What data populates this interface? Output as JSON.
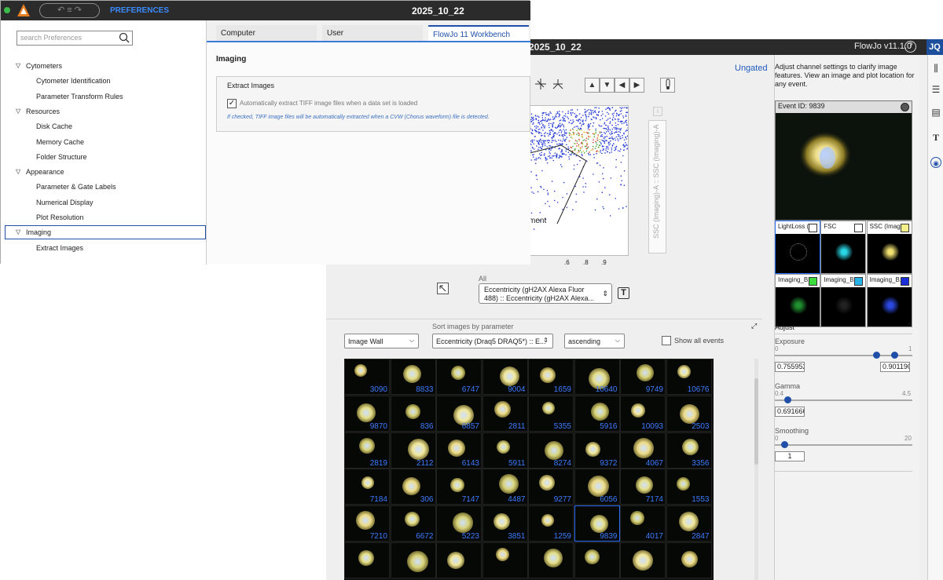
{
  "prefs": {
    "window_title": "PREFERENCES",
    "date": "2025_10_22",
    "search_placeholder": "search Preferences",
    "tree": [
      {
        "label": "Cytometers",
        "level": 0
      },
      {
        "label": "Cytometer Identification",
        "level": 1
      },
      {
        "label": "Parameter Transform Rules",
        "level": 1
      },
      {
        "label": "Resources",
        "level": 0
      },
      {
        "label": "Disk Cache",
        "level": 1
      },
      {
        "label": "Memory Cache",
        "level": 1
      },
      {
        "label": "Folder Structure",
        "level": 1
      },
      {
        "label": "Appearance",
        "level": 0
      },
      {
        "label": "Parameter & Gate Labels",
        "level": 1
      },
      {
        "label": "Numerical Display",
        "level": 1
      },
      {
        "label": "Plot Resolution",
        "level": 1
      },
      {
        "label": "Imaging",
        "level": 0
      },
      {
        "label": "Extract Images",
        "level": 1
      }
    ],
    "tabs": [
      "Computer",
      "User",
      "FlowJo 11 Workbench"
    ],
    "section_title": "Imaging",
    "group_title": "Extract Images",
    "checkbox_label": "Automatically extract TIFF image files when a data set is loaded",
    "checkbox_checked": true,
    "hint": "If checked, TIFF image files will be automatically extracted when a CVW (Chorus waveform) file is detected."
  },
  "main": {
    "date": "2025_10_22",
    "version": "FlowJo v11.1.0",
    "help": "?",
    "user": "JQ",
    "ungated": "Ungated",
    "plot_label": "ment",
    "y_axis_label": "SSC (Imaging)-A :: SSC (Imaging)-A",
    "x_ticks": [
      ".6",
      ".8",
      ".9"
    ],
    "all_label": "All",
    "param_select": "Eccentricity (gH2AX Alexa Fluor 488) :: Eccentricity (gH2AX Alexa...",
    "view_select": "Image Wall",
    "sort_label": "Sort images by parameter",
    "sort_select": "Eccentricity (Draq5 DRAQ5*) :: E...",
    "order_select": "ascending",
    "show_all": "Show all events",
    "wall_ids": [
      [
        "3090",
        "8833",
        "6747",
        "9004",
        "1659",
        "10640",
        "9749",
        "10676"
      ],
      [
        "9870",
        "836",
        "6857",
        "2811",
        "5355",
        "5916",
        "10093",
        "2503"
      ],
      [
        "2819",
        "2112",
        "6143",
        "5911",
        "8274",
        "9372",
        "4067",
        "3356"
      ],
      [
        "7184",
        "306",
        "7147",
        "4487",
        "9277",
        "6056",
        "7174",
        "1553"
      ],
      [
        "7210",
        "6672",
        "5223",
        "3851",
        "1259",
        "9839",
        "4017",
        "2847"
      ],
      [
        "",
        "",
        "",
        "",
        "",
        "",
        "",
        ""
      ]
    ],
    "selected_event": "9839"
  },
  "right": {
    "instructions": "Adjust channel settings to clarify image features. View an image and plot location for any event.",
    "event_id": "Event ID: 9839",
    "channels": [
      {
        "label": "LightLoss (...",
        "color": "#ffffff"
      },
      {
        "label": "FSC",
        "color": "#ffffff"
      },
      {
        "label": "SSC (Imagi...",
        "color": "#f4f08a"
      },
      {
        "label": "Imaging_B...",
        "color": "#3bdc3b"
      },
      {
        "label": "Imaging_B...",
        "color": "#27b3e8"
      },
      {
        "label": "Imaging_B...",
        "color": "#1b2fd9"
      }
    ],
    "adjust": "Adjust",
    "exposure": "Exposure",
    "exposure_min": "0",
    "exposure_max": "1",
    "exposure_low": "0.755952",
    "exposure_high": "0.901190",
    "gamma": "Gamma",
    "gamma_min": "0.4",
    "gamma_max": "4.5",
    "gamma_val": "0.691666",
    "smoothing": "Smoothing",
    "smooth_min": "0",
    "smooth_max": "20",
    "smooth_val": "1"
  }
}
